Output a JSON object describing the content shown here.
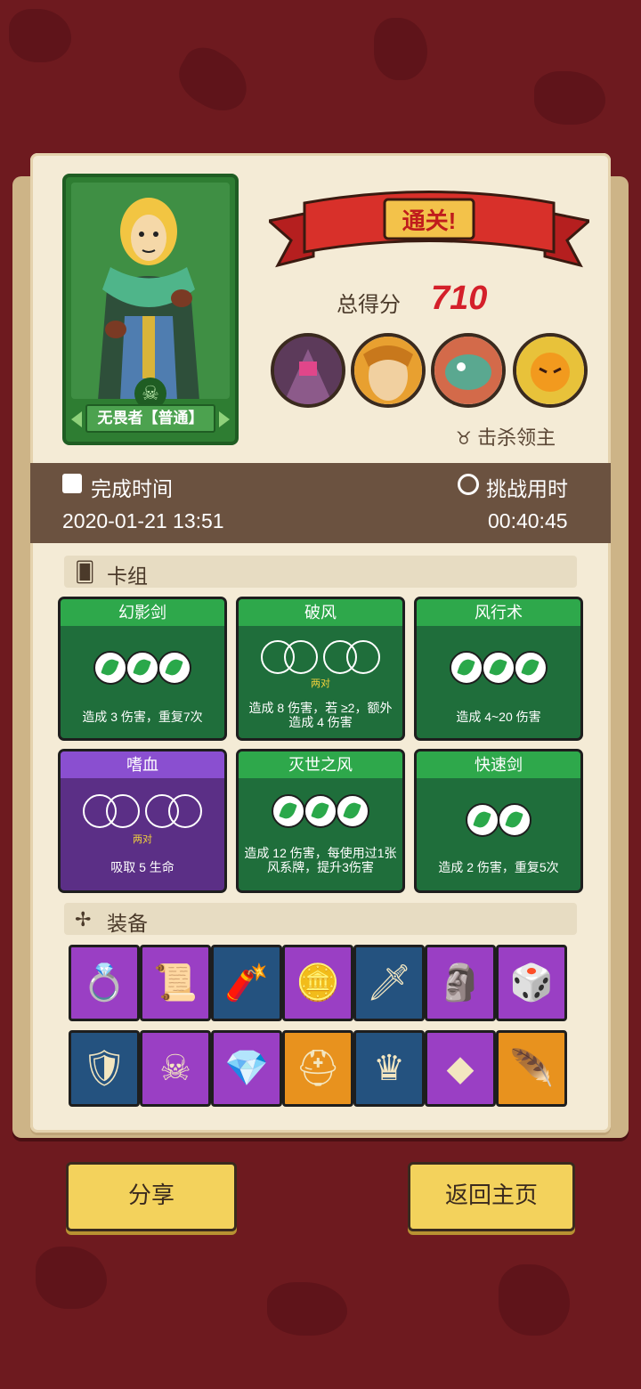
{
  "hero": {
    "name": "无畏者【普通】"
  },
  "result": {
    "banner": "通关!",
    "score_label": "总得分",
    "score": "710",
    "kill_label": "击杀领主"
  },
  "time": {
    "finish_label": "完成时间",
    "finish_value": "2020-01-21 13:51",
    "challenge_label": "挑战用时",
    "challenge_value": "00:40:45"
  },
  "deck": {
    "title": "卡组",
    "cards": [
      {
        "name": "幻影剑",
        "desc": "造成 3 伤害，重复7次",
        "kind": "green"
      },
      {
        "name": "破风",
        "desc": "造成 8 伤害，若 ≥2，额外造成 4 伤害",
        "pair": "两对",
        "kind": "green"
      },
      {
        "name": "风行术",
        "desc": "造成 4~20 伤害",
        "kind": "green"
      },
      {
        "name": "嗜血",
        "desc": "吸取 5 生命",
        "pair": "两对",
        "kind": "purple"
      },
      {
        "name": "灭世之风",
        "desc": "造成 12 伤害，每使用过1张 风系牌，提升3伤害",
        "kind": "green"
      },
      {
        "name": "快速剑",
        "desc": "造成 2 伤害，重复5次",
        "kind": "green"
      }
    ]
  },
  "equipment": {
    "title": "装备",
    "items": [
      {
        "icon": "ring-icon",
        "color": "purple"
      },
      {
        "icon": "scroll-icon",
        "color": "purple"
      },
      {
        "icon": "bomb-stick-icon",
        "color": "blue"
      },
      {
        "icon": "coin-icon",
        "color": "purple"
      },
      {
        "icon": "dagger-icon",
        "color": "blue"
      },
      {
        "icon": "mask-icon",
        "color": "purple"
      },
      {
        "icon": "dice-icon",
        "color": "purple"
      },
      {
        "icon": "shield-round-icon",
        "color": "blue"
      },
      {
        "icon": "skull-scroll-icon",
        "color": "purple"
      },
      {
        "icon": "crystal-icon",
        "color": "purple"
      },
      {
        "icon": "helmet-icon",
        "color": "orange"
      },
      {
        "icon": "crown-icon",
        "color": "blue"
      },
      {
        "icon": "emerald-icon",
        "color": "purple"
      },
      {
        "icon": "feather-icon",
        "color": "orange"
      }
    ]
  },
  "buttons": {
    "share": "分享",
    "home": "返回主页"
  }
}
